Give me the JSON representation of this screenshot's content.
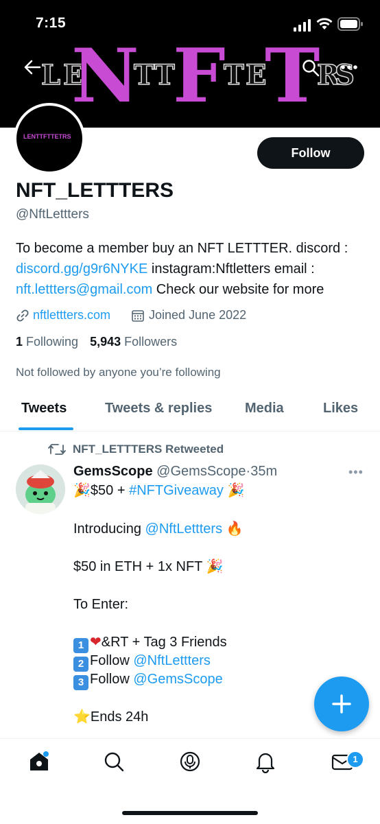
{
  "status": {
    "time": "7:15"
  },
  "banner": {
    "big_letters": [
      "N",
      "F",
      "T"
    ],
    "small_letters": [
      "L",
      "E",
      "T",
      "T",
      "T",
      "E",
      "R",
      "S"
    ]
  },
  "profile": {
    "avatar_text": "LENTTFTTETRS",
    "follow_label": "Follow",
    "name": "NFT_LETTTERS",
    "handle": "@NftLettters",
    "bio_1": "To become a member buy an NFT LETTTER. discord :",
    "bio_link_1": "discord.gg/g9r6NYKE",
    "bio_2": " instagram:Nftletters email :",
    "bio_link_2": "nft.lettters@gmail.com",
    "bio_3": " Check our website for more",
    "website": "nftlettters.com",
    "joined": "Joined June 2022",
    "following_count": "1",
    "following_label": "Following",
    "followers_count": "5,943",
    "followers_label": "Followers",
    "not_followed": "Not followed by anyone you’re following"
  },
  "tabs": [
    {
      "label": "Tweets"
    },
    {
      "label": "Tweets & replies"
    },
    {
      "label": "Media"
    },
    {
      "label": "Likes"
    }
  ],
  "tweet": {
    "retweeted_by": "NFT_LETTTERS Retweeted",
    "author_name": "GemsScope",
    "author_handle": "@GemsScope",
    "dot": "·",
    "time": "35m",
    "more": "•••",
    "l1_pre": "$50 + ",
    "l1_tag": "#NFTGiveaway",
    "l2_pre": "Introducing ",
    "l2_mention": "@NftLettters",
    "l3": "$50 in ETH + 1x NFT",
    "l4": "To Enter:",
    "l5": "&RT + Tag 3 Friends",
    "l6_pre": "Follow ",
    "l6_mention": "@NftLettters",
    "l7_pre": "Follow ",
    "l7_mention": "@GemsScope",
    "l8": "Ends 24h",
    "key1": "1",
    "key2": "2",
    "key3": "3"
  },
  "nav": {
    "messages_badge": "1"
  },
  "colors": {
    "accent": "#1d9bf0",
    "banner_purple": "#c84bd4",
    "text": "#0f1419",
    "muted": "#536471"
  }
}
